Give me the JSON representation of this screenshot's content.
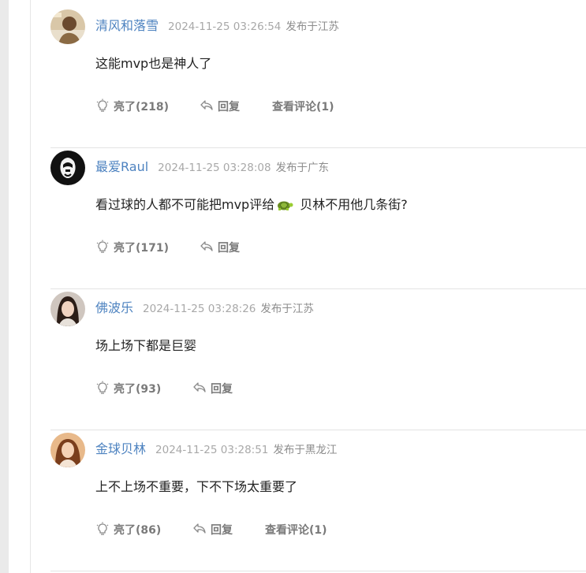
{
  "icons": {
    "like": "lightbulb-icon",
    "reply": "reply-arrow-icon",
    "emoji": "turtle-icon"
  },
  "colors": {
    "username": "#4e83c0",
    "time": "#a8a8a8",
    "action": "#7a7a7a",
    "text": "#222222"
  },
  "comments": [
    {
      "username": "清风和落雪",
      "time": "2024-11-25 03:26:54",
      "location": "发布于江苏",
      "content": "这能mvp也是神人了",
      "like_label": "亮了(218)",
      "reply_label": "回复",
      "view_replies_label": "查看评论(1)"
    },
    {
      "username": "最爱Raul",
      "time": "2024-11-25 03:28:08",
      "location": "发布于广东",
      "content_before": "看过球的人都不可能把mvp评给",
      "content_after": "贝林不用他几条街?",
      "like_label": "亮了(171)",
      "reply_label": "回复"
    },
    {
      "username": "佛波乐",
      "time": "2024-11-25 03:28:26",
      "location": "发布于江苏",
      "content": "场上场下都是巨婴",
      "like_label": "亮了(93)",
      "reply_label": "回复"
    },
    {
      "username": "金球贝林",
      "time": "2024-11-25 03:28:51",
      "location": "发布于黑龙江",
      "content": "上不上场不重要，下不下场太重要了",
      "like_label": "亮了(86)",
      "reply_label": "回复",
      "view_replies_label": "查看评论(1)"
    }
  ]
}
